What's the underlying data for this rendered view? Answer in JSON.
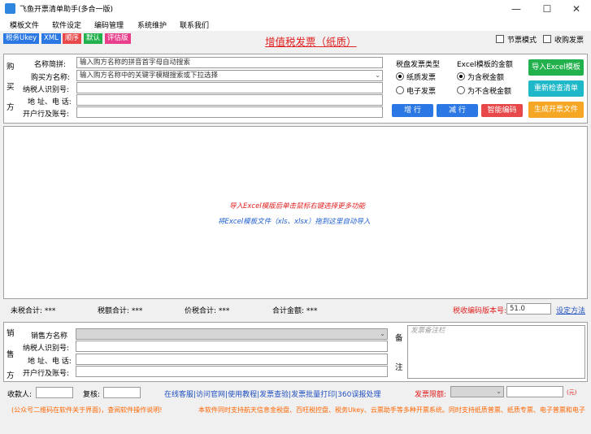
{
  "window": {
    "title": "飞鱼开票清单助手(多合一版)",
    "minimize": "—",
    "maximize": "☐",
    "close": "✕"
  },
  "menu": [
    "模板文件",
    "软件设定",
    "编码管理",
    "系统维护",
    "联系我们"
  ],
  "badges": [
    {
      "label": "税务Ukey",
      "color": "#2b78e4"
    },
    {
      "label": "XML",
      "color": "#2b78e4"
    },
    {
      "label": "顺序",
      "color": "#e8484a"
    },
    {
      "label": "默认",
      "color": "#22b14c"
    },
    {
      "label": "评估版",
      "color": "#e83e8c"
    }
  ],
  "doc_title": "增值税发票（纸质）",
  "options": {
    "save_mode": "节票模式",
    "collect_invoice": "收购发票"
  },
  "buyer": {
    "side_label": [
      "购",
      "买",
      "方"
    ],
    "fields": [
      {
        "label": "名称简拼:",
        "value": "输入购方名称的拼音首字母自动搜索"
      },
      {
        "label": "购买方名称:",
        "value": "输入购方名称中的关键字模糊搜索或下拉选择"
      },
      {
        "label": "纳税人识别号:",
        "value": ""
      },
      {
        "label": "地 址、电 话:",
        "value": ""
      },
      {
        "label": "开户行及账号:",
        "value": ""
      }
    ]
  },
  "tax_type": {
    "title": "税盘发票类型",
    "options": [
      "纸质发票",
      "电子发票"
    ],
    "selected": 0
  },
  "amount_type": {
    "title": "Excel模板的金额",
    "options": [
      "为含税金额",
      "为不含税金额"
    ],
    "selected": 0
  },
  "actions": {
    "add_row": "增 行",
    "del_row": "减 行",
    "smart_code": "智能编码",
    "import_excel": "导入Excel模板",
    "recheck": "重新检查清单",
    "generate": "生成开票文件"
  },
  "colors": {
    "blue": "#2b78e4",
    "red": "#e8484a",
    "green": "#22b14c",
    "cyan": "#1fb8c8",
    "orange": "#f5a623"
  },
  "hints": {
    "line1": "导入Excel模版后单击鼠标右键选择更多功能",
    "line2": "将Excel模板文件（xls、xlsx）拖到这里自动导入"
  },
  "totals": {
    "untaxed": "未税合计: ***",
    "tax": "税额合计: ***",
    "total_with_tax": "价税合计: ***",
    "amount": "合计金额: ***",
    "code_version_label": "税收编码版本号:",
    "code_version_value": "51.0",
    "set_method": "设定方法"
  },
  "seller": {
    "side_label": [
      "销",
      "售",
      "方"
    ],
    "fields": [
      {
        "label": "销售方名称",
        "value": ""
      },
      {
        "label": "纳税人识别号:",
        "value": ""
      },
      {
        "label": "地 址、电 话:",
        "value": ""
      },
      {
        "label": "开户行及账号:",
        "value": ""
      }
    ]
  },
  "remark": {
    "side_label": [
      "备",
      "注"
    ],
    "placeholder": "发票备注栏"
  },
  "bottom": {
    "payee": "收款人:",
    "reviewer": "复核:",
    "links": "在线客服|访问官网|使用教程|发票查验|发票批量打印|360误报处理",
    "limit_label": "发票限额:",
    "limit_unit": "(元)"
  },
  "footer": {
    "left": "(公众号二维码在软件关于界面)，查阅软件操作说明!",
    "right": "本软件同时支持航天信息金税盘、百旺税控盘、税务Ukey、云票助手等多种开票系统。同时支持纸质普票、纸质专票、电子普票和电子"
  }
}
